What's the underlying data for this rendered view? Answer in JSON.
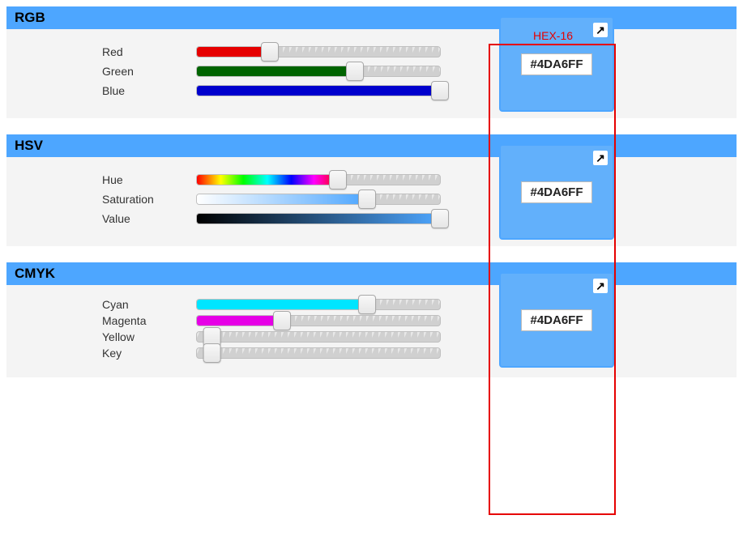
{
  "color_hex": "#4DA6FF",
  "swatch_bg": "#62b0fb",
  "annotation": {
    "label": "HEX-16"
  },
  "panels": {
    "rgb": {
      "title": "RGB",
      "sliders": [
        {
          "label": "Red",
          "fill_color": "#e60000",
          "value_pct": 30
        },
        {
          "label": "Green",
          "fill_color": "#006400",
          "value_pct": 65
        },
        {
          "label": "Blue",
          "fill_color": "#0000cd",
          "value_pct": 100
        }
      ]
    },
    "hsv": {
      "title": "HSV",
      "sliders": [
        {
          "label": "Hue",
          "grad": "hue",
          "value_pct": 58
        },
        {
          "label": "Saturation",
          "grad": "sat",
          "value_pct": 70
        },
        {
          "label": "Value",
          "grad": "val",
          "value_pct": 100
        }
      ]
    },
    "cmyk": {
      "title": "CMYK",
      "sliders": [
        {
          "label": "Cyan",
          "fill_color": "#00e5ff",
          "value_pct": 70
        },
        {
          "label": "Magenta",
          "fill_color": "#e600e6",
          "value_pct": 35
        },
        {
          "label": "Yellow",
          "fill_color": "#ffff00",
          "value_pct": 0
        },
        {
          "label": "Key",
          "fill_color": "#000000",
          "value_pct": 0
        }
      ]
    }
  }
}
